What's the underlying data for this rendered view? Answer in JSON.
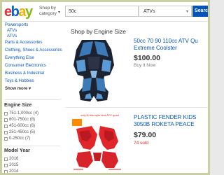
{
  "header": {
    "logo_letters": [
      {
        "char": "e",
        "color": "#e53238"
      },
      {
        "char": "b",
        "color": "#0064d2"
      },
      {
        "char": "a",
        "color": "#f5af02"
      },
      {
        "char": "y",
        "color": "#86b817"
      }
    ],
    "shop_by_line1": "Shop by",
    "shop_by_line2": "category",
    "chevron_icon": "chevron-down-icon",
    "search_value": "50c",
    "category_value": "ATVs",
    "search_button": "Search",
    "button_color": "#0654ba"
  },
  "sidebar": {
    "links": [
      "Powersports",
      "ATVs",
      "ATVs",
      "Parts & Accessories",
      "Clothing, Shoes & Accessories",
      "Everything Else",
      "Consumer Electronics",
      "Business & Industrial",
      "Toys & Hobbies"
    ],
    "show_more": "Show more ▾",
    "engine_size_heading": "Engine Size",
    "engine_sizes": [
      "751-1,000cc",
      "601-750cc",
      "451-600cc",
      "251-450cc",
      "0-250cc"
    ],
    "engine_counts": [
      "(4)",
      "(8)",
      "(6)",
      "(5)",
      "(7)"
    ],
    "model_year_heading": "Model Year",
    "model_years": [
      "2016",
      "2015",
      "2014"
    ]
  },
  "main": {
    "panel_title": "Shop by Engine Size",
    "listings": [
      {
        "title_line1": "50cc 70 90 110cc ATV Qu",
        "title_line2": "Extreme Coolster",
        "price": "$100.00",
        "buy_label": "Buy It Now",
        "sold": ""
      },
      {
        "title_line1": "PLASTIC FENDER KIDS",
        "title_line2": "3050B ROKETA PEACE",
        "price": "$79.00",
        "buy_label": "Buy It Now",
        "sold": "74 sold",
        "image_caption": "only fit this style kids ATV quad"
      }
    ]
  },
  "colors": {
    "link": "#0654ba",
    "sold": "#dd1e31",
    "frame": "#c9cfa0"
  }
}
